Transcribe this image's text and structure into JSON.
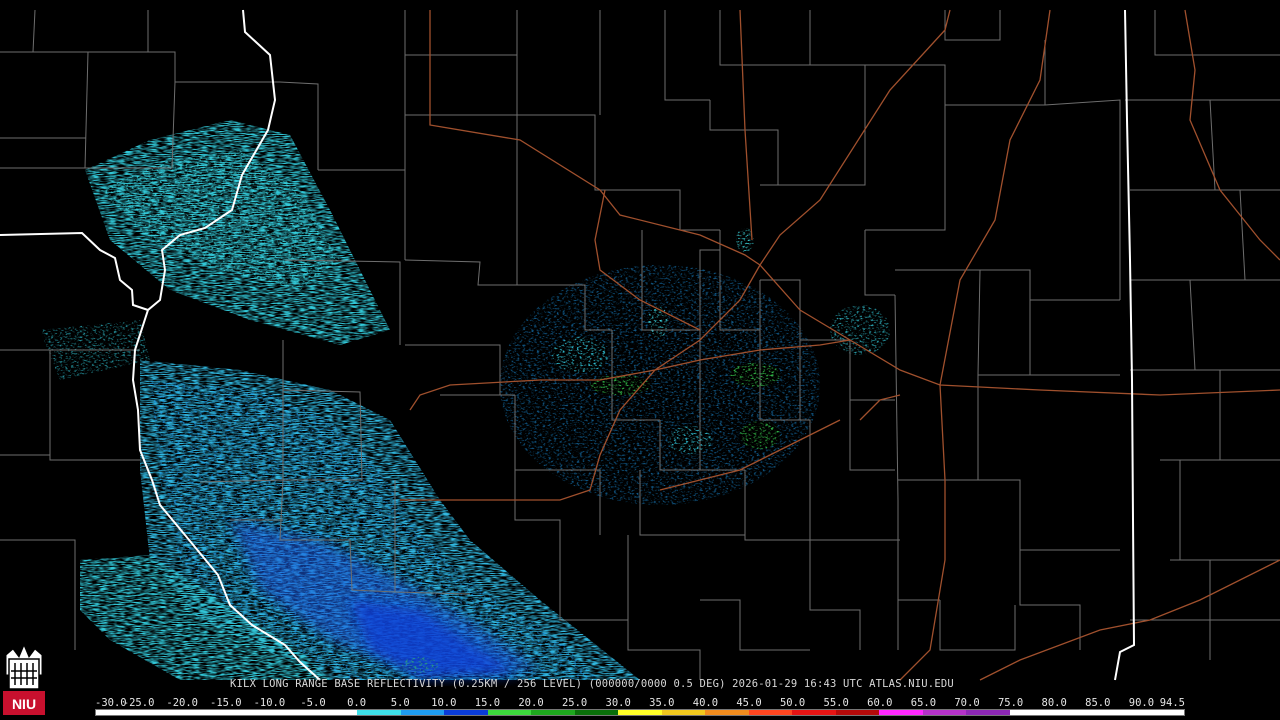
{
  "caption": "KILX LONG RANGE BASE REFLECTIVITY (0.25KM / 256 LEVEL) (000000/0000 0.5 DEG) 2026-01-29 16:43 UTC  ATLAS.NIU.EDU",
  "logo_text": "NIU",
  "colorbar": {
    "labels": [
      "-30.0",
      "-25.0",
      "-20.0",
      "-15.0",
      "-10.0",
      "-5.0",
      "0.0",
      "5.0",
      "10.0",
      "15.0",
      "20.0",
      "25.0",
      "30.0",
      "35.0",
      "40.0",
      "45.0",
      "50.0",
      "55.0",
      "60.0",
      "65.0",
      "70.0",
      "75.0",
      "80.0",
      "85.0",
      "90.0",
      "94.5"
    ],
    "colors": [
      "#ffffff",
      "#ffffff",
      "#ffffff",
      "#ffffff",
      "#ffffff",
      "#ffffff",
      "#3ee0e8",
      "#1e9cf0",
      "#0a3cd8",
      "#3cd83c",
      "#1ea81e",
      "#0a700a",
      "#ffff28",
      "#f0c81e",
      "#f08c1e",
      "#ff4620",
      "#e61414",
      "#b40a0a",
      "#ff28ff",
      "#b432c8",
      "#8c28b4",
      "#ffffff",
      "#ffffff",
      "#ffffff",
      "#ffffff"
    ]
  },
  "colors": {
    "background": "#000000",
    "county_lines": "#6e6e6e",
    "state_lines": "#ffffff",
    "highways": "#a0502d"
  }
}
